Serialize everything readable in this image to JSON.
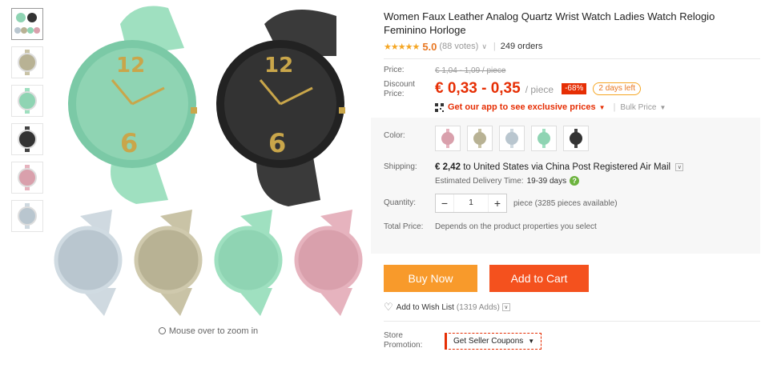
{
  "product": {
    "title": "Women Faux Leather Analog Quartz Wrist Watch Ladies Watch Relogio Feminino Horloge",
    "stars": "★★★★★",
    "rating": "5.0",
    "votes": "(88 votes)",
    "orders": "249 orders"
  },
  "price": {
    "price_label": "Price:",
    "old_price": "€ 1,04 - 1,09 / piece",
    "discount_label": "Discount Price:",
    "new_price": "€ 0,33 - 0,35",
    "per_piece": "/ piece",
    "discount_badge": "-68%",
    "days_left": "2 days left",
    "app_promo": "Get our app to see exclusive prices",
    "bulk_price": "Bulk Price"
  },
  "options": {
    "color_label": "Color:",
    "colors": [
      {
        "name": "pink",
        "hex": "#d9a0ac"
      },
      {
        "name": "khaki",
        "hex": "#b8b294"
      },
      {
        "name": "light-blue",
        "hex": "#b9c6cf"
      },
      {
        "name": "mint",
        "hex": "#8fd4b3"
      },
      {
        "name": "black",
        "hex": "#333333"
      }
    ],
    "shipping_label": "Shipping:",
    "shipping_cost": "€ 2,42",
    "shipping_to": "to United States via China Post Registered Air Mail",
    "est_label": "Estimated Delivery Time:",
    "est_days": "19-39 days",
    "quantity_label": "Quantity:",
    "quantity_value": "1",
    "availability": "piece (3285 pieces available)",
    "total_label": "Total Price:",
    "total_value": "Depends on the product properties you select"
  },
  "actions": {
    "buy_now": "Buy Now",
    "add_to_cart": "Add to Cart",
    "wishlist": "Add to Wish List",
    "wishlist_adds": "(1319 Adds)",
    "store_promo_label": "Store Promotion:",
    "coupons": "Get Seller Coupons"
  },
  "gallery": {
    "zoom_hint": "Mouse over to zoom in"
  },
  "colors": {
    "accent_red": "#e62e04",
    "accent_orange": "#f89a2b",
    "cart_red": "#f4511e",
    "star": "#f5a623"
  }
}
